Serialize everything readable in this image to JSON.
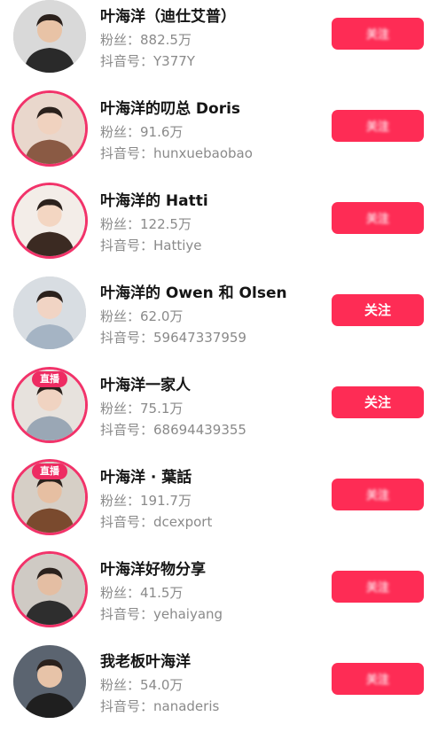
{
  "accounts": [
    {
      "name": "叶海洋（迪仕艾普）",
      "fans": "粉丝：882.5万",
      "douyin_id": "抖音号：Y377Y",
      "follow_label": "关注",
      "blurred": true,
      "ring": false,
      "live": "",
      "avatar_icon": "man-black-shirt-avatar",
      "avatar_bg": "#d9d9d9",
      "avatar_fg": "#2a2a2a",
      "skin": "#e8c3a6"
    },
    {
      "name": "叶海洋的叨总 Doris",
      "fans": "粉丝：91.6万",
      "douyin_id": "抖音号：hunxuebaobao",
      "follow_label": "关注",
      "blurred": true,
      "ring": true,
      "live": "",
      "avatar_icon": "woman-with-child-avatar",
      "avatar_bg": "#e9d7cc",
      "avatar_fg": "#8a5a44",
      "skin": "#f0d2bf"
    },
    {
      "name": "叶海洋的 Hatti",
      "fans": "粉丝：122.5万",
      "douyin_id": "抖音号：Hattiye",
      "follow_label": "关注",
      "blurred": true,
      "ring": true,
      "live": "",
      "avatar_icon": "toddler-avatar",
      "avatar_bg": "#f3ede8",
      "avatar_fg": "#3b2a22",
      "skin": "#f3d6c2"
    },
    {
      "name": "叶海洋的 Owen 和 Olsen",
      "fans": "粉丝：62.0万",
      "douyin_id": "抖音号：59647337959",
      "follow_label": "关注",
      "blurred": false,
      "ring": false,
      "live": "",
      "avatar_icon": "twin-babies-avatar",
      "avatar_bg": "#d8dde2",
      "avatar_fg": "#a5b4c4",
      "skin": "#f1d4c4"
    },
    {
      "name": "叶海洋一家人",
      "fans": "粉丝：75.1万",
      "douyin_id": "抖音号：68694439355",
      "follow_label": "关注",
      "blurred": false,
      "ring": true,
      "live": "直播",
      "avatar_icon": "family-avatar",
      "avatar_bg": "#e7e2dd",
      "avatar_fg": "#9aa7b5",
      "skin": "#f0d3c1"
    },
    {
      "name": "叶海洋 · 葉話",
      "fans": "粉丝：191.7万",
      "douyin_id": "抖音号：dcexport",
      "follow_label": "关注",
      "blurred": true,
      "ring": true,
      "live": "直播",
      "avatar_icon": "man-brown-shirt-avatar",
      "avatar_bg": "#d6cfc6",
      "avatar_fg": "#7a4a2e",
      "skin": "#e6bfa2"
    },
    {
      "name": "叶海洋好物分享",
      "fans": "粉丝：41.5万",
      "douyin_id": "抖音号：yehaiyang",
      "follow_label": "关注",
      "blurred": true,
      "ring": true,
      "live": "",
      "avatar_icon": "man-at-table-avatar",
      "avatar_bg": "#cfcac4",
      "avatar_fg": "#2e2e2e",
      "skin": "#e4bea3"
    },
    {
      "name": "我老板叶海洋",
      "fans": "粉丝：54.0万",
      "douyin_id": "抖音号：nanaderis",
      "follow_label": "关注",
      "blurred": true,
      "ring": false,
      "live": "",
      "avatar_icon": "man-suit-avatar",
      "avatar_bg": "#5b6470",
      "avatar_fg": "#1f1f1f",
      "skin": "#e7c3a8"
    }
  ],
  "colors": {
    "follow_button": "#fe2c55",
    "live_ring": "#f2336a",
    "live_badge": "#ee2b62"
  }
}
